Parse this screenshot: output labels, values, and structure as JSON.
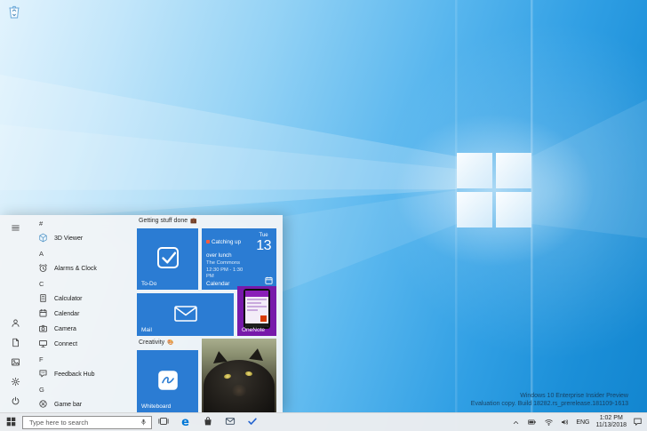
{
  "desktop": {
    "watermark": {
      "line1": "Windows 10 Enterprise Insider Preview",
      "line2": "Evaluation copy. Build 18282.rs_prerelease.181109-1613"
    }
  },
  "start_menu": {
    "app_list": [
      {
        "type": "header",
        "label": "#"
      },
      {
        "type": "app",
        "label": "3D Viewer",
        "icon": "3d-viewer-icon"
      },
      {
        "type": "header",
        "label": "A"
      },
      {
        "type": "app",
        "label": "Alarms & Clock",
        "icon": "alarms-clock-icon"
      },
      {
        "type": "header",
        "label": "C"
      },
      {
        "type": "app",
        "label": "Calculator",
        "icon": "calculator-icon"
      },
      {
        "type": "app",
        "label": "Calendar",
        "icon": "calendar-icon"
      },
      {
        "type": "app",
        "label": "Camera",
        "icon": "camera-icon"
      },
      {
        "type": "app",
        "label": "Connect",
        "icon": "connect-icon"
      },
      {
        "type": "header",
        "label": "F"
      },
      {
        "type": "app",
        "label": "Feedback Hub",
        "icon": "feedback-hub-icon"
      },
      {
        "type": "header",
        "label": "G"
      },
      {
        "type": "app",
        "label": "Game bar",
        "icon": "game-bar-icon"
      }
    ],
    "rail_icons": [
      "hamburger-icon",
      "user-icon",
      "documents-icon",
      "pictures-icon",
      "settings-gear-icon",
      "power-icon"
    ],
    "tile_groups": {
      "group1_label": "Getting stuff done",
      "group1_emoji": "💼",
      "group2_label": "Creativity",
      "group2_emoji": "🎨"
    },
    "tiles": {
      "todo": {
        "label": "To-Do"
      },
      "calendar": {
        "event_title": "Catching up over lunch",
        "event_location": "The Commons",
        "event_time": "12:30 PM - 1:30 PM",
        "weekday": "Tue",
        "day": "13",
        "label": "Calendar"
      },
      "mail": {
        "label": "Mail"
      },
      "onenote": {
        "label": "OneNote"
      },
      "whiteboard": {
        "label": "Whiteboard"
      }
    }
  },
  "taskbar": {
    "search_placeholder": "Type here to search",
    "icons": {
      "edge_glyph": "e",
      "pinned": [
        "task-view-icon",
        "edge-icon",
        "store-icon",
        "mail-icon",
        "todo-check-icon"
      ],
      "tray": [
        "hidden-icons-caret-icon",
        "battery-icon",
        "network-wifi-icon",
        "volume-icon",
        "action-center-icon"
      ]
    },
    "tray": {
      "language": "ENG",
      "time": "1:02 PM",
      "date": "11/13/2018"
    }
  },
  "colors": {
    "accent_blue": "#0078d7",
    "tile_blue": "#2b7cd3",
    "onenote_purple": "#7719aa",
    "taskbar_bg": "#ececee",
    "menu_bg": "#f2f4f6"
  }
}
